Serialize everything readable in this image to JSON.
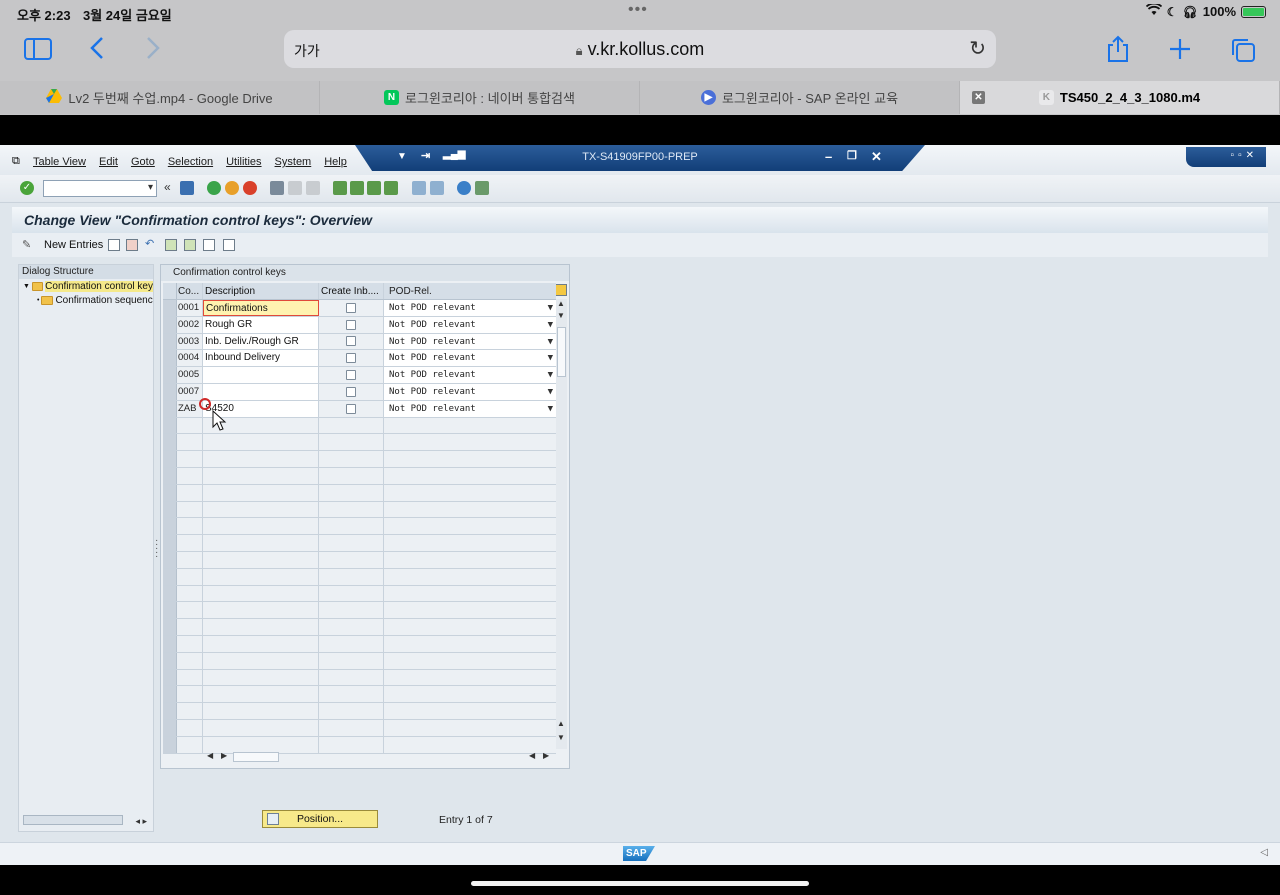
{
  "status": {
    "time": "오후 2:23",
    "date": "3월 24일 금요일",
    "battery": "100%"
  },
  "safari": {
    "text_size_label": "가가",
    "url": "v.kr.kollus.com",
    "tabs": [
      {
        "label": "Lv2 두번째 수업.mp4 - Google Drive",
        "icon": "google-drive-icon"
      },
      {
        "label": "로그윈코리아 : 네이버 통합검색",
        "icon": "naver-icon"
      },
      {
        "label": "로그윈코리아 - SAP 온라인 교육",
        "icon": "play-icon"
      },
      {
        "label": "TS450_2_4_3_1080.m4",
        "icon": "k-icon",
        "active": true
      }
    ]
  },
  "sap": {
    "menus": [
      "Table View",
      "Edit",
      "Goto",
      "Selection",
      "Utilities",
      "System",
      "Help"
    ],
    "system_title": "TX-S41909FP00-PREP",
    "screen_title": "Change View \"Confirmation control keys\": Overview",
    "new_entries_label": "New Entries",
    "dialog_structure": {
      "header": "Dialog Structure",
      "nodes": [
        "Confirmation control key",
        "Confirmation sequenc"
      ]
    },
    "table": {
      "caption": "Confirmation control keys",
      "columns": [
        "Co...",
        "Description",
        "Create Inb....",
        "POD-Rel."
      ],
      "rows": [
        {
          "key": "0001",
          "description": "Confirmations",
          "create_inb": false,
          "pod": "Not POD relevant"
        },
        {
          "key": "0002",
          "description": "Rough GR",
          "create_inb": false,
          "pod": "Not POD relevant"
        },
        {
          "key": "0003",
          "description": "Inb. Deliv./Rough GR",
          "create_inb": false,
          "pod": "Not POD relevant"
        },
        {
          "key": "0004",
          "description": "Inbound Delivery",
          "create_inb": false,
          "pod": "Not POD relevant"
        },
        {
          "key": "0005",
          "description": "",
          "create_inb": false,
          "pod": "Not POD relevant"
        },
        {
          "key": "0007",
          "description": "",
          "create_inb": false,
          "pod": "Not POD relevant"
        },
        {
          "key": "ZAB",
          "description": "S4520",
          "create_inb": false,
          "pod": "Not POD relevant"
        }
      ],
      "empty_rows": 20
    },
    "position_button": "Position...",
    "entry_info": "Entry 1 of 7",
    "logo": "SAP"
  }
}
